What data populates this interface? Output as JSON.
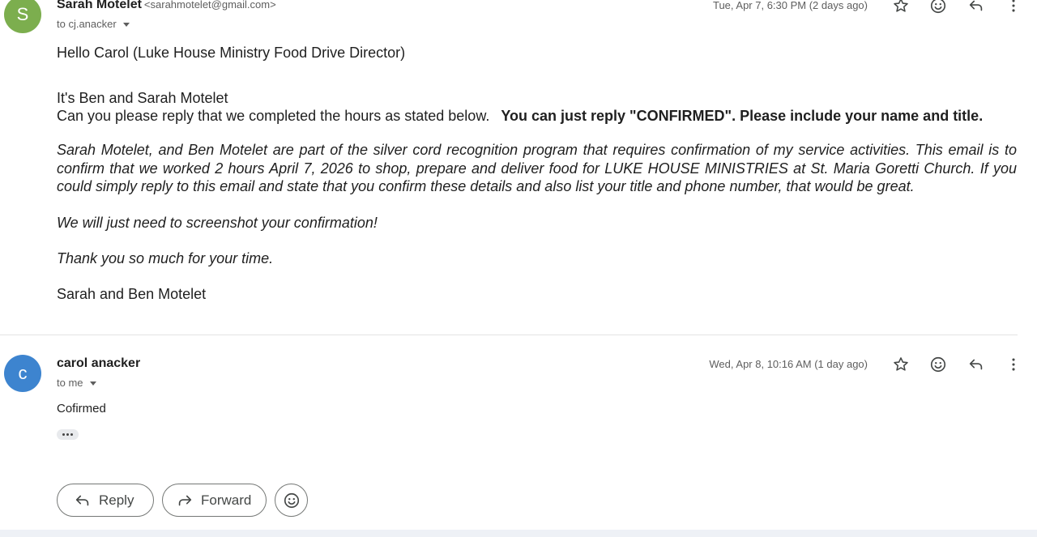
{
  "message1": {
    "avatar_letter": "S",
    "sender_name": "Sarah Motelet",
    "sender_email": "<sarahmotelet@gmail.com>",
    "to": "to cj.anacker",
    "date": "Tue, Apr 7, 6:30 PM (2 days ago)",
    "greeting": "Hello Carol (Luke House Ministry Food Drive Director)",
    "intro": "It's Ben and Sarah Motelet",
    "request": "Can you please reply that we completed the hours as stated below.",
    "request_bold": "You can just reply \"CONFIRMED\". Please include your name and title.",
    "paragraph": "Sarah Motelet, and Ben Motelet are part of the silver cord recognition program that requires confirmation of my service activities. This email is to confirm that we worked 2 hours April 7, 2026 to shop, prepare and deliver food for LUKE HOUSE MINISTRIES at St. Maria Goretti Church.   If you could simply reply to this email and state that you confirm these details and also list your title and phone number, that would be great.",
    "screenshot_note": "We will just need to screenshot your confirmation!",
    "thanks": "Thank you so much for your time.",
    "signature": "Sarah and Ben Motelet"
  },
  "message2": {
    "avatar_letter": "c",
    "sender_name": "carol anacker",
    "to": "to me",
    "date": "Wed, Apr 8, 10:16 AM (1 day ago)",
    "body": "Cofirmed"
  },
  "actions": {
    "reply_label": "Reply",
    "forward_label": "Forward"
  },
  "icons": [
    "star-icon",
    "emoji-icon",
    "reply-icon",
    "more-vert-icon",
    "forward-icon",
    "chevron-down-icon"
  ],
  "colors": {
    "avatar_s": "#7cae4e",
    "avatar_c": "#3d84cf"
  }
}
